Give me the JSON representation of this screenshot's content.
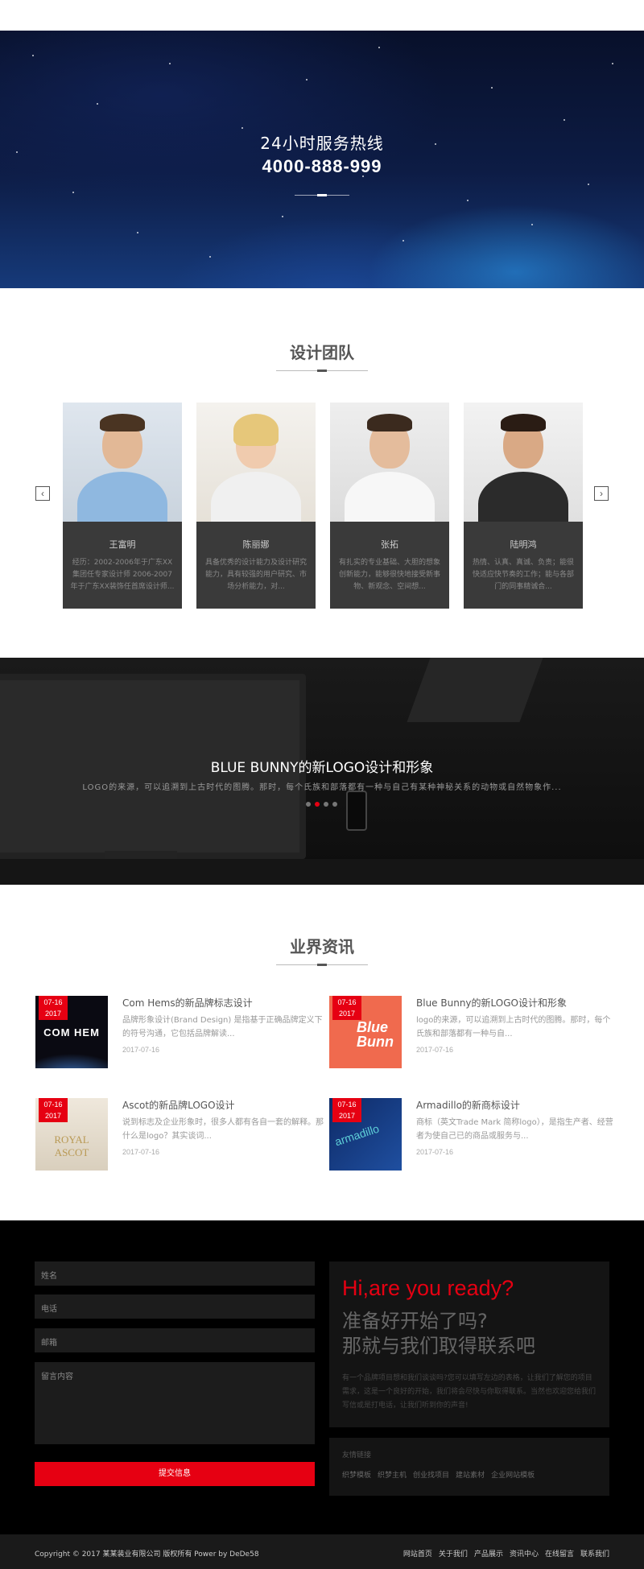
{
  "hero": {
    "line1": "24小时服务热线",
    "line2": "4000-888-999"
  },
  "team": {
    "title": "设计团队",
    "members": [
      {
        "name": "王富明",
        "desc": "经历：2002-2006年于广东XX集团任专家设计师 2006-2007年于广东XX装饰任首席设计师..."
      },
      {
        "name": "陈丽娜",
        "desc": "具备优秀的设计能力及设计研究能力，具有较强的用户研究、市场分析能力，对..."
      },
      {
        "name": "张拓",
        "desc": "有扎实的专业基础、大胆的想象创新能力，能够很快地接受新事物、新观念、空间想..."
      },
      {
        "name": "陆明鸿",
        "desc": "热情、认真、真诚、负责；能很快适应快节奏的工作；能与各部门的同事精诚合..."
      }
    ]
  },
  "banner": {
    "title": "BLUE BUNNY的新LOGO设计和形象",
    "subtitle": "LOGO的来源，可以追溯到上古时代的图腾。那时，每个氏族和部落都有一种与自己有某种神秘关系的动物或自然物象作..."
  },
  "news": {
    "title": "业界资讯",
    "items": [
      {
        "date_md": "07-16",
        "date_y": "2017",
        "title": "Com Hems的新品牌标志设计",
        "desc": "品牌形象设计(Brand Design) 是指基于正确品牌定义下的符号沟通，它包括品牌解读...",
        "time": "2017-07-16",
        "thumb_text": "COM HEM"
      },
      {
        "date_md": "07-16",
        "date_y": "2017",
        "title": "Blue Bunny的新LOGO设计和形象",
        "desc": "logo的来源，可以追溯到上古时代的图腾。那时，每个氏族和部落都有一种与自...",
        "time": "2017-07-16",
        "thumb_text": "Blue Bunn"
      },
      {
        "date_md": "07-16",
        "date_y": "2017",
        "title": "Ascot的新品牌LOGO设计",
        "desc": "说到标志及企业形象时，很多人都有各自一套的解释。那什么是logo？其实谈词...",
        "time": "2017-07-16",
        "thumb_text": "ROYAL ASCOT"
      },
      {
        "date_md": "07-16",
        "date_y": "2017",
        "title": "Armadillo的新商标设计",
        "desc": "商标（英文Trade Mark 简称logo），是指生产者、经营者为使自己已的商品或服务与...",
        "time": "2017-07-16",
        "thumb_text": "armadillo"
      }
    ]
  },
  "contact": {
    "name_placeholder": "姓名",
    "phone_placeholder": "电话",
    "email_placeholder": "邮箱",
    "message_placeholder": "留言内容",
    "submit_label": "提交信息",
    "ready_heading": "Hi,are you ready?",
    "ready_sub1": "准备好开始了吗?",
    "ready_sub2": "那就与我们取得联系吧",
    "ready_text": "有一个品牌项目想和我们谈谈吗?您可以填写左边的表格，让我们了解您的项目需求，这是一个良好的开始，我们将会尽快与你取得联系。当然也欢迎您给我们写信或是打电话，让我们听到你的声音!",
    "links_title": "友情链接",
    "links": [
      "织梦模板",
      "织梦主机",
      "创业找项目",
      "建站素材",
      "企业网站模板"
    ]
  },
  "footer": {
    "copyright": "Copyright © 2017 某某装业有限公司 版权所有 Power by DeDe58",
    "nav": [
      "网站首页",
      "关于我们",
      "产品展示",
      "资讯中心",
      "在线留言",
      "联系我们"
    ]
  },
  "colors": {
    "accent": "#e60012",
    "dark": "#000000",
    "card": "#3a3a3a"
  }
}
